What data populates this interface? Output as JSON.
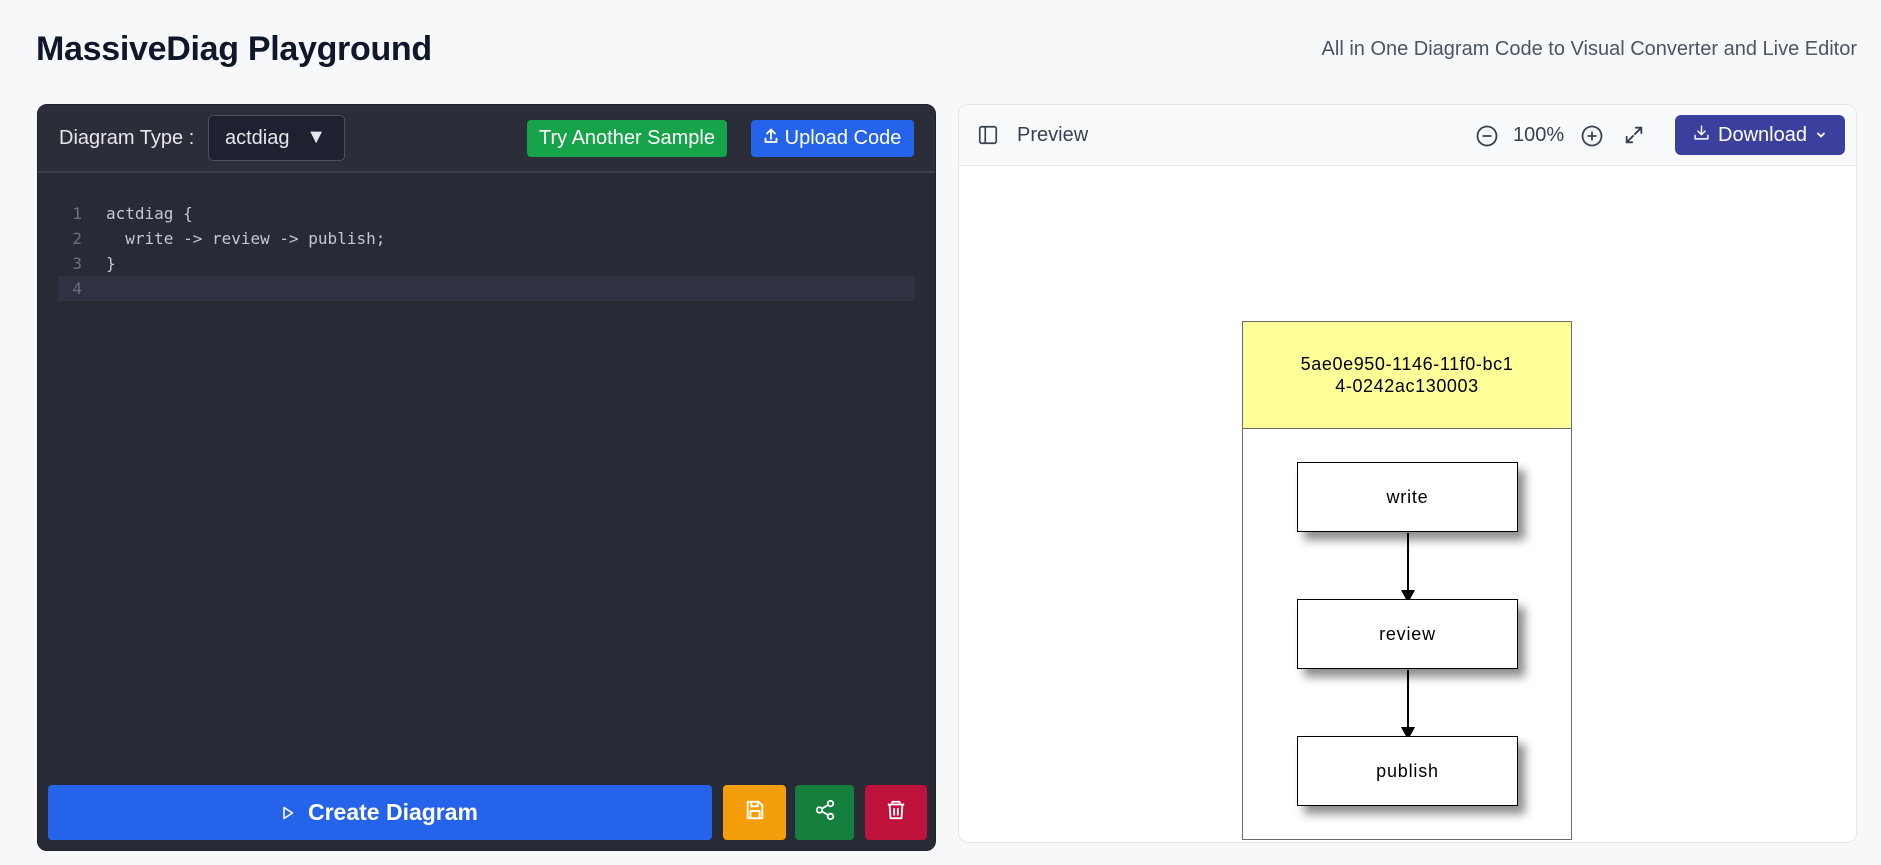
{
  "header": {
    "title": "MassiveDiag Playground",
    "subtitle": "All in One Diagram Code to Visual Converter and Live Editor"
  },
  "editor": {
    "diagram_type_label": "Diagram Type :",
    "diagram_type_value": "actdiag",
    "try_sample_label": "Try Another Sample",
    "upload_label": "Upload Code",
    "lines": [
      {
        "num": "1",
        "text": "actdiag {"
      },
      {
        "num": "2",
        "text": "  write -> review -> publish;"
      },
      {
        "num": "3",
        "text": "}"
      },
      {
        "num": "4",
        "text": ""
      }
    ],
    "create_label": "Create Diagram"
  },
  "preview": {
    "title": "Preview",
    "zoom": "100%",
    "download_label": "Download",
    "diagram": {
      "lane_title": "5ae0e950-1146-11f0-bc14-0242ac130003",
      "nodes": [
        "write",
        "review",
        "publish"
      ]
    }
  },
  "colors": {
    "accent_blue": "#2563eb",
    "green": "#16a34a",
    "amber": "#f59e0b",
    "dark_green": "#15803d",
    "crimson": "#be123c",
    "indigo": "#3b3f9e",
    "lane_yellow": "#ffff99"
  },
  "icons": {
    "caret": "caret-down-icon",
    "upload": "upload-icon",
    "play": "play-icon",
    "save": "save-icon",
    "share": "share-icon",
    "delete": "trash-icon",
    "sidebar": "sidebar-toggle-icon",
    "zoom_out": "zoom-out-icon",
    "zoom_in": "zoom-in-icon",
    "fullscreen": "fullscreen-icon",
    "download": "download-icon",
    "chevron": "chevron-down-icon"
  }
}
